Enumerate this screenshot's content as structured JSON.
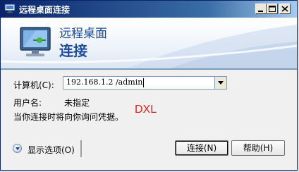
{
  "window": {
    "title": "远程桌面连接",
    "controls": {
      "minimize": "minimize",
      "maximize": "maximize",
      "close": "close"
    }
  },
  "banner": {
    "line1": "远程桌面",
    "line2": "连接"
  },
  "form": {
    "computer_label": "计算机(C):",
    "computer_value": "192.168.1.2 /admin",
    "user_label": "用户名:",
    "user_value": "未指定",
    "info_text": "当你连接时将向你询问凭据。"
  },
  "annotation": {
    "text": "DXL",
    "color": "#e02020"
  },
  "footer": {
    "options_label": "显示选项(O)",
    "connect_label": "连接(N)",
    "help_label": "帮助(H)"
  },
  "colors": {
    "titlebar": "#0a246a",
    "banner_text": "#1c4c9a",
    "window_bg": "#f0f0f0"
  },
  "icons": {
    "title": "remote-desktop-icon",
    "banner": "monitor-connection-icon",
    "options": "chevron-down-icon",
    "combo": "dropdown-arrow-icon"
  }
}
